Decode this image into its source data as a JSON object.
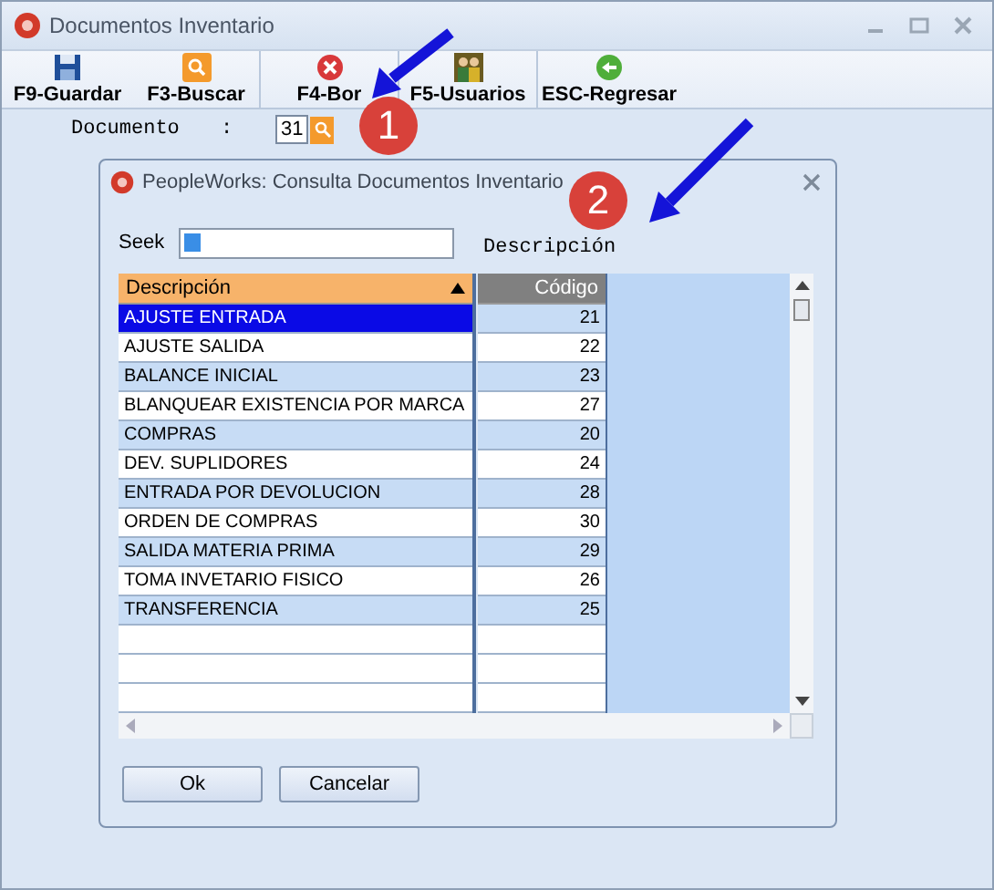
{
  "window": {
    "title": "Documentos Inventario"
  },
  "toolbar": [
    {
      "label": "F9-Guardar",
      "kind": "save"
    },
    {
      "label": "F3-Buscar",
      "kind": "search"
    },
    {
      "label": "F4-Bor",
      "kind": "delete"
    },
    {
      "label": "F5-Usuarios",
      "kind": "users"
    },
    {
      "label": "ESC-Regresar",
      "kind": "back"
    }
  ],
  "document_field": {
    "label": "Documento",
    "separator": ":",
    "value": "31"
  },
  "dialog": {
    "title": "PeopleWorks: Consulta Documentos Inventario",
    "seek_label": "Seek",
    "search_by": "Descripción",
    "table": {
      "columns": [
        {
          "label": "Descripción",
          "sorted": true
        },
        {
          "label": "Código",
          "sorted": false
        }
      ],
      "rows": [
        {
          "description": "AJUSTE ENTRADA",
          "code": "21",
          "selected": true
        },
        {
          "description": "AJUSTE SALIDA",
          "code": "22",
          "selected": false
        },
        {
          "description": "BALANCE INICIAL",
          "code": "23",
          "selected": false
        },
        {
          "description": "BLANQUEAR EXISTENCIA POR MARCA",
          "code": "27",
          "selected": false
        },
        {
          "description": "COMPRAS",
          "code": "20",
          "selected": false
        },
        {
          "description": "DEV. SUPLIDORES",
          "code": "24",
          "selected": false
        },
        {
          "description": "ENTRADA POR DEVOLUCION",
          "code": "28",
          "selected": false
        },
        {
          "description": "ORDEN DE COMPRAS",
          "code": "30",
          "selected": false
        },
        {
          "description": "SALIDA MATERIA PRIMA",
          "code": "29",
          "selected": false
        },
        {
          "description": "TOMA INVETARIO FISICO",
          "code": "26",
          "selected": false
        },
        {
          "description": "TRANSFERENCIA",
          "code": "25",
          "selected": false
        }
      ]
    },
    "buttons": [
      "Ok",
      "Cancelar"
    ]
  },
  "callouts": [
    {
      "number": "1"
    },
    {
      "number": "2"
    }
  ]
}
